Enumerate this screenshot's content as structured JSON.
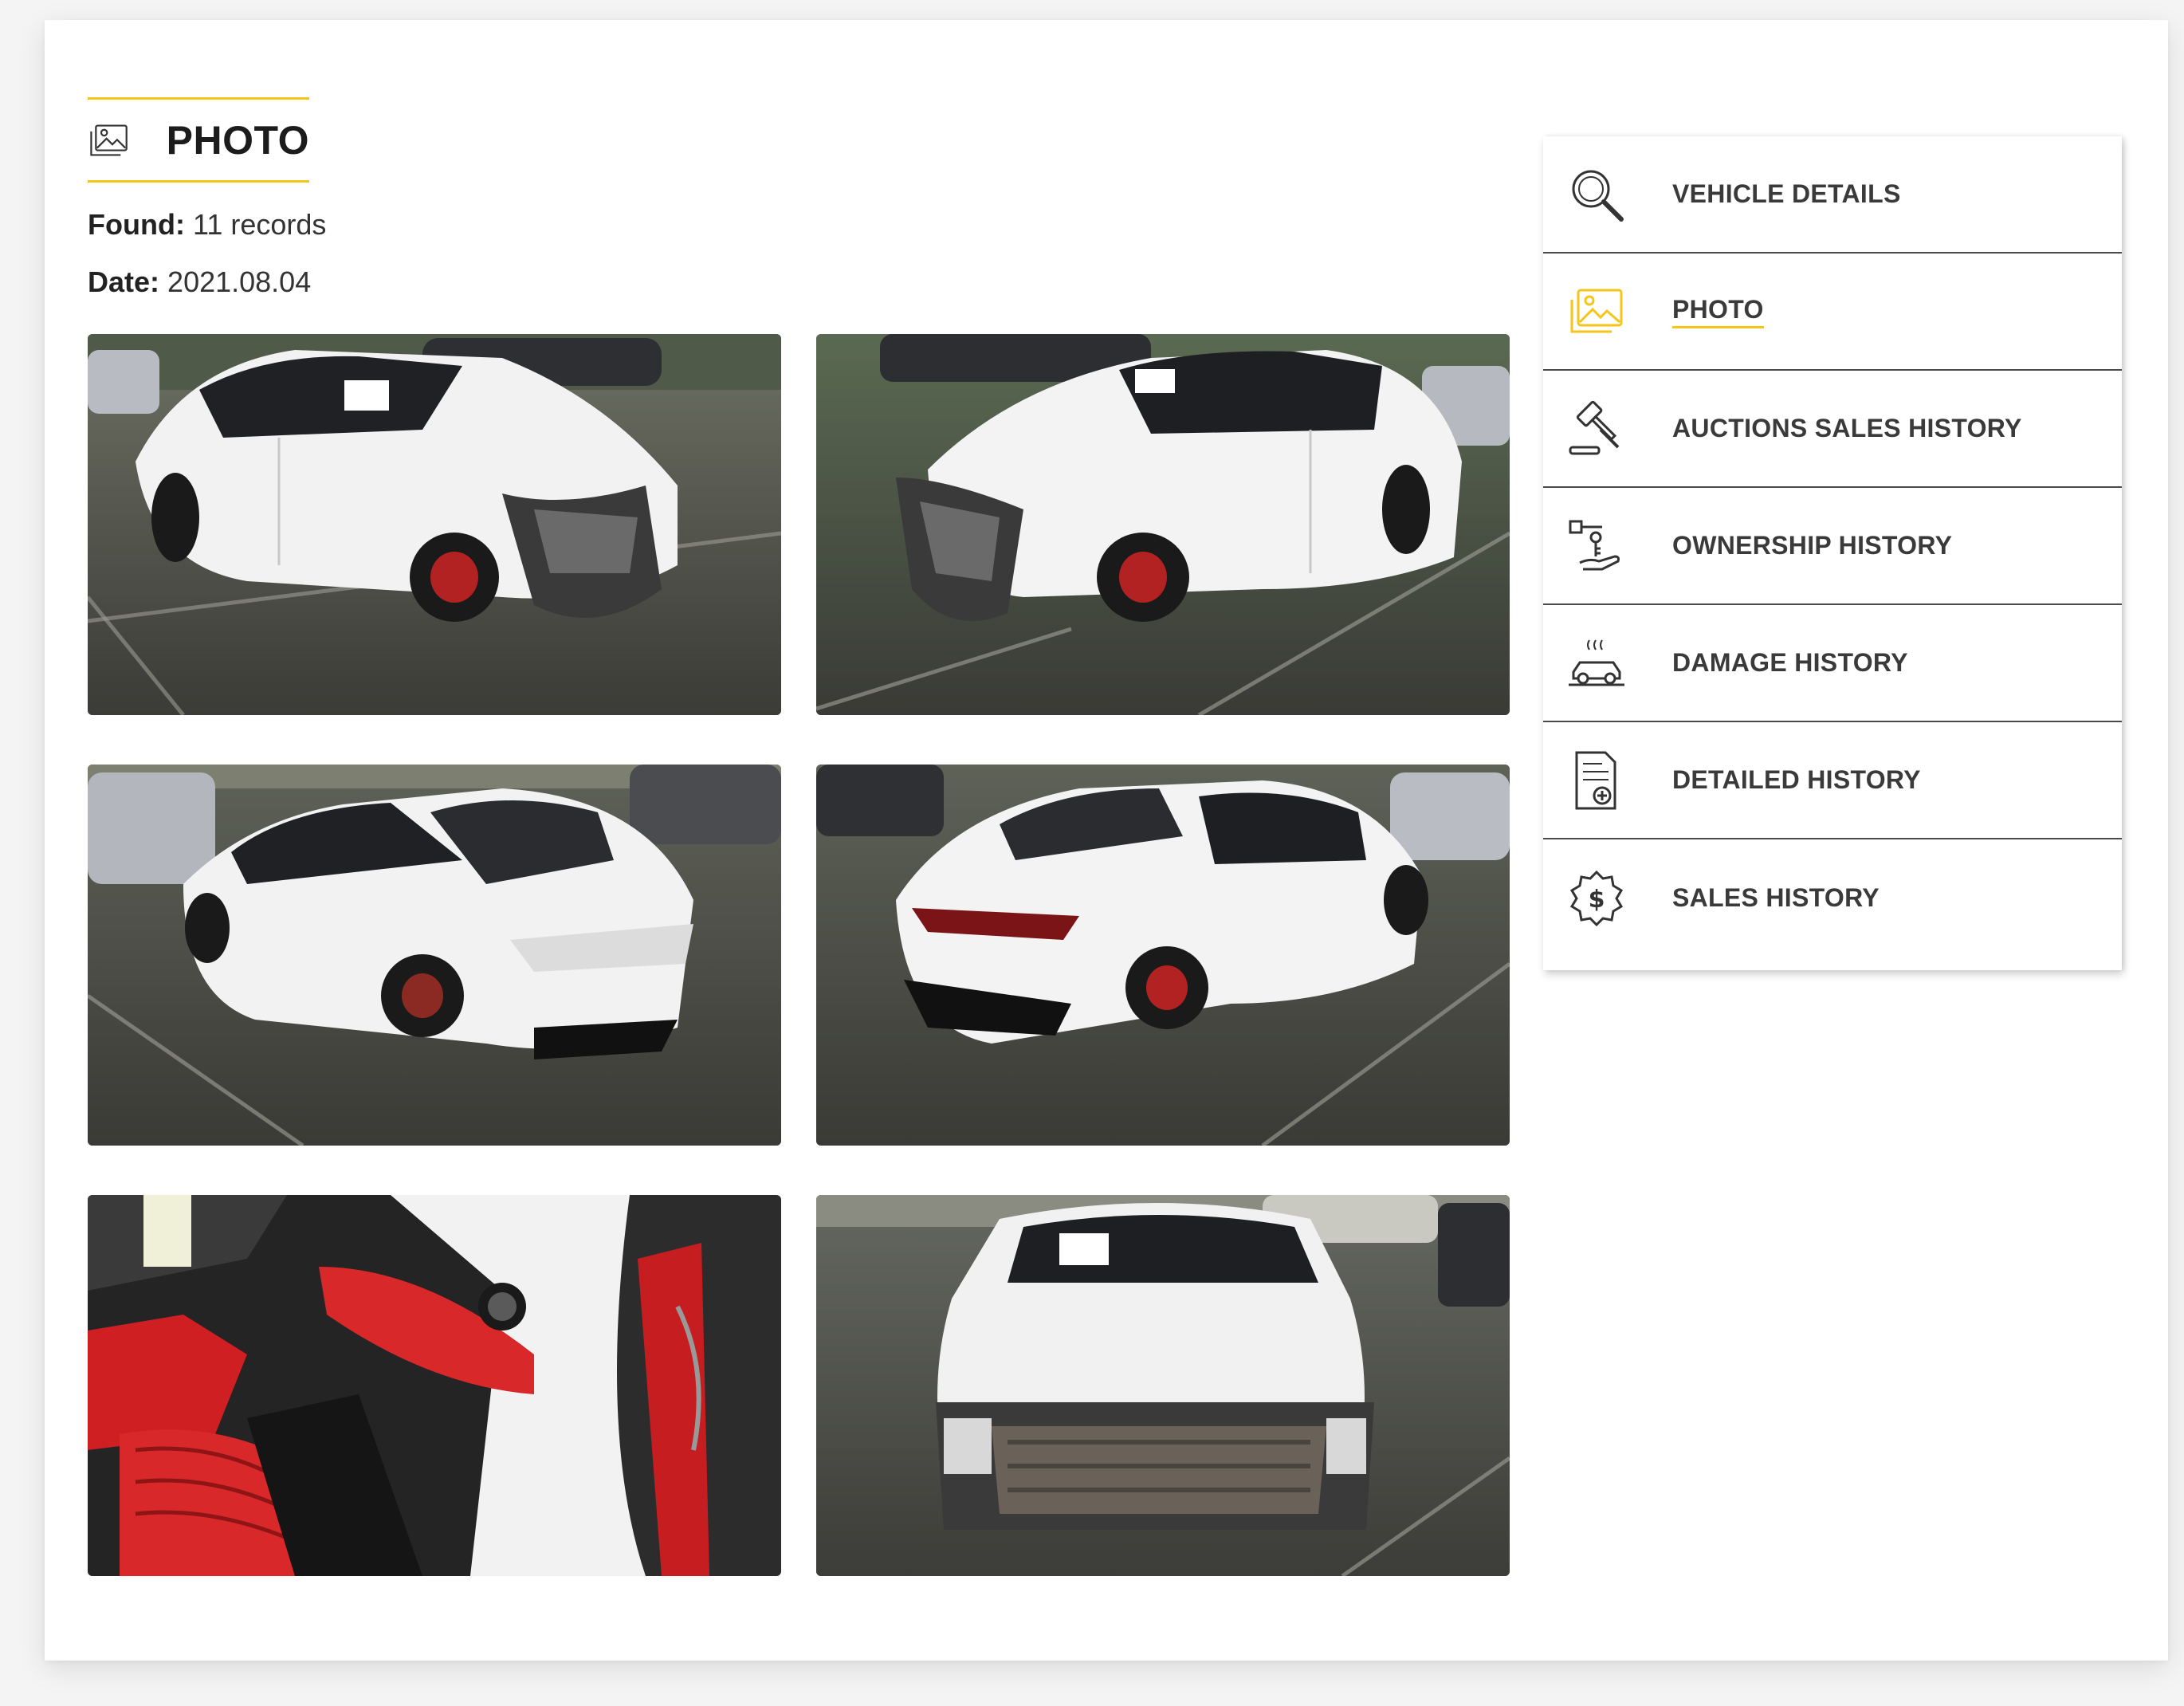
{
  "section": {
    "title": "PHOTO",
    "icon": "photo-icon"
  },
  "meta": {
    "found_label": "Found:",
    "found_value": "11 records",
    "date_label": "Date:",
    "date_value": "2021.08.04"
  },
  "photos": [
    {
      "subject": "front-right three-quarter view, damaged front"
    },
    {
      "subject": "front-left three-quarter view, damaged front"
    },
    {
      "subject": "rear-left three-quarter view"
    },
    {
      "subject": "rear-right three-quarter view"
    },
    {
      "subject": "interior, red leather seats"
    },
    {
      "subject": "front view, damaged bumper"
    }
  ],
  "nav": {
    "items": [
      {
        "label": "VEHICLE DETAILS",
        "icon": "magnifier-icon",
        "active": false
      },
      {
        "label": "PHOTO",
        "icon": "photo-icon",
        "active": true
      },
      {
        "label": "AUCTIONS SALES HISTORY",
        "icon": "gavel-icon",
        "active": false
      },
      {
        "label": "OWNERSHIP HISTORY",
        "icon": "key-hand-icon",
        "active": false
      },
      {
        "label": "DAMAGE HISTORY",
        "icon": "damaged-car-icon",
        "active": false
      },
      {
        "label": "DETAILED HISTORY",
        "icon": "document-plus-icon",
        "active": false
      },
      {
        "label": "SALES HISTORY",
        "icon": "dollar-badge-icon",
        "active": false
      }
    ]
  },
  "colors": {
    "accent": "#f5c518",
    "text": "#3a3a3a",
    "divider": "#4a4a4a"
  }
}
